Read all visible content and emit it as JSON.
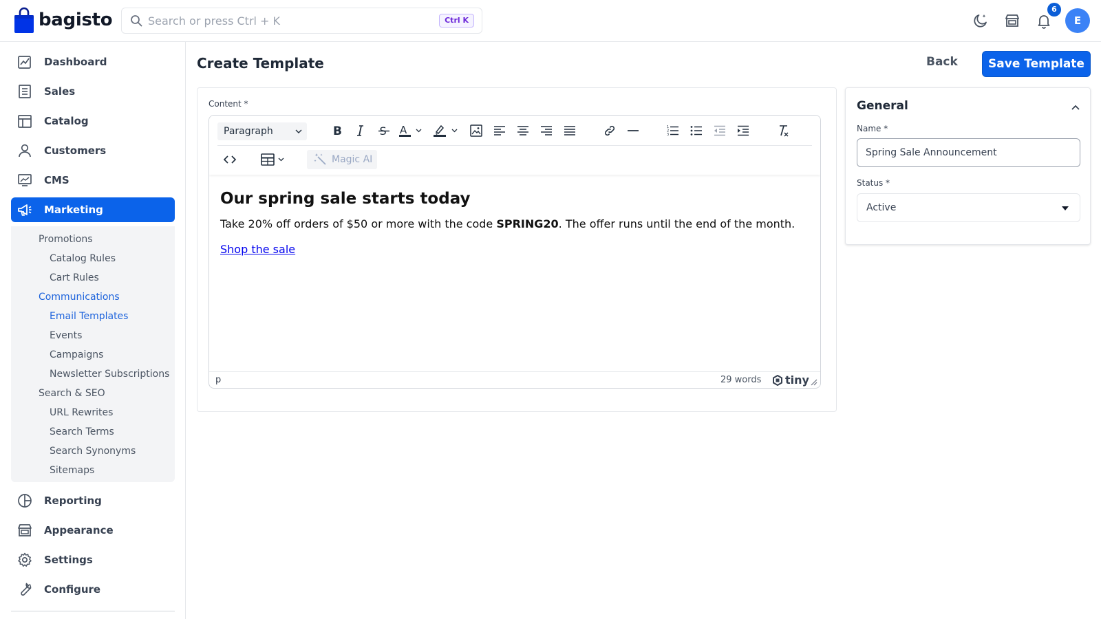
{
  "header": {
    "logo_text": "bagisto",
    "search_placeholder": "Search or press Ctrl + K",
    "shortcut": "Ctrl K",
    "notification_count": "6",
    "avatar_initial": "E",
    "icons": [
      "moon-icon",
      "store-icon",
      "bell-icon"
    ]
  },
  "sidebar": {
    "items": [
      {
        "label": "Dashboard",
        "icon": "dashboard-icon"
      },
      {
        "label": "Sales",
        "icon": "receipt-icon"
      },
      {
        "label": "Catalog",
        "icon": "catalog-icon"
      },
      {
        "label": "Customers",
        "icon": "user-icon"
      },
      {
        "label": "CMS",
        "icon": "monitor-icon"
      },
      {
        "label": "Marketing",
        "icon": "megaphone-icon",
        "active": true
      },
      {
        "label": "Reporting",
        "icon": "pie-chart-icon"
      },
      {
        "label": "Appearance",
        "icon": "storefront-icon"
      },
      {
        "label": "Settings",
        "icon": "gear-icon"
      },
      {
        "label": "Configure",
        "icon": "wrench-icon"
      }
    ],
    "marketing_sub": {
      "promotions": "Promotions",
      "catalog_rules": "Catalog Rules",
      "cart_rules": "Cart Rules",
      "communications": "Communications",
      "email_templates": "Email Templates",
      "events": "Events",
      "campaigns": "Campaigns",
      "newsletter_subscriptions": "Newsletter Subscriptions",
      "search_seo": "Search & SEO",
      "url_rewrites": "URL Rewrites",
      "search_terms": "Search Terms",
      "search_synonyms": "Search Synonyms",
      "sitemaps": "Sitemaps"
    }
  },
  "page": {
    "title": "Create Template",
    "back_label": "Back",
    "save_label": "Save Template"
  },
  "content": {
    "label": "Content *",
    "block_format": "Paragraph",
    "magic_ai": "Magic AI",
    "heading": "Our spring sale starts today",
    "paragraph_before": "Take 20% off orders of $50 or more with the code ",
    "code": "SPRING20",
    "paragraph_after": ". The offer runs until the end of the month.",
    "link_text": "Shop the sale",
    "path": "p",
    "word_count": "29 words",
    "brand": "tiny"
  },
  "general": {
    "title": "General",
    "name_label": "Name *",
    "name_value": "Spring Sale Announcement",
    "status_label": "Status *",
    "status_value": "Active"
  },
  "colors": {
    "primary": "#0b63ea",
    "link": "#0000ee",
    "sub_active": "#1d63dc"
  }
}
